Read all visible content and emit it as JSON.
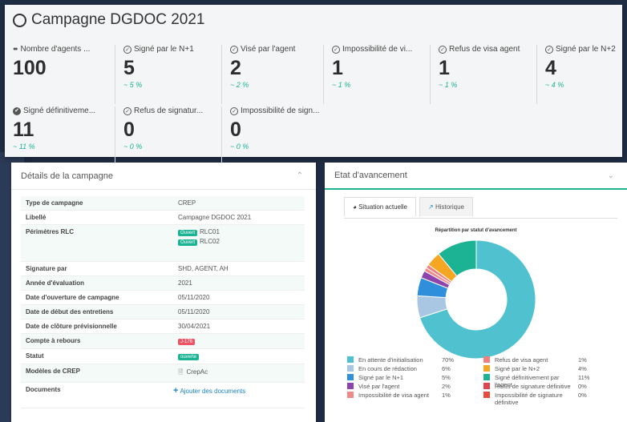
{
  "header": {
    "title": "Campagne DGDOC 2021"
  },
  "stats": [
    {
      "icon": "users-icon",
      "label": "Nombre d'agents ...",
      "value": "100",
      "pct": ""
    },
    {
      "icon": "check-circle-icon",
      "label": "Signé par le N+1",
      "value": "5",
      "pct": "~ 5 %"
    },
    {
      "icon": "check-circle-icon",
      "label": "Visé par l'agent",
      "value": "2",
      "pct": "~ 2 %"
    },
    {
      "icon": "check-circle-icon",
      "label": "Impossibilité de vi...",
      "value": "1",
      "pct": "~ 1 %"
    },
    {
      "icon": "check-circle-icon",
      "label": "Refus de visa agent",
      "value": "1",
      "pct": "~ 1 %"
    },
    {
      "icon": "check-circle-icon",
      "label": "Signé par le N+2",
      "value": "4",
      "pct": "~ 4 %"
    },
    {
      "icon": "check-circle-filled-icon",
      "label": "Signé définitiveme...",
      "value": "11",
      "pct": "~ 11 %"
    },
    {
      "icon": "check-circle-icon",
      "label": "Refus de signatur...",
      "value": "0",
      "pct": "~ 0 %"
    },
    {
      "icon": "check-circle-icon",
      "label": "Impossibilité de sign...",
      "value": "0",
      "pct": "~ 0 %"
    }
  ],
  "details": {
    "title": "Détails de la campagne",
    "rows": [
      {
        "key": "Type de campagne",
        "value": "CREP"
      },
      {
        "key": "Libellé",
        "value": "Campagne DGDOC 2021"
      },
      {
        "key": "Périmètres RLC",
        "tag": "Ouvert",
        "value": "RLC01",
        "tag2": "Ouvert",
        "value2": "RLC02"
      },
      {
        "key": "Signature par",
        "value": "SHD, AGENT, AH"
      },
      {
        "key": "Année d'évaluation",
        "value": "2021"
      },
      {
        "key": "Date d'ouverture de campagne",
        "value": "05/11/2020"
      },
      {
        "key": "Date de début des entretiens",
        "value": "05/11/2020"
      },
      {
        "key": "Date de clôture prévisionnelle",
        "value": "30/04/2021"
      },
      {
        "key": "Compte à rebours",
        "tag": "J-176"
      },
      {
        "key": "Statut",
        "tag": "ouverte"
      },
      {
        "key": "Modèles de CREP",
        "value": "CrepAc"
      },
      {
        "key": "Documents",
        "link": "Ajouter des documents"
      }
    ]
  },
  "progress": {
    "title": "Etat d'avancement",
    "tabs": [
      "Situation actuelle",
      "Historique"
    ]
  },
  "chart_data": {
    "type": "pie",
    "title": "Répartition par statut d'avancement",
    "slices": [
      {
        "name": "En attente d'initialisation",
        "value": 70,
        "label": "70%",
        "color": "#4fc1cf"
      },
      {
        "name": "En cours de rédaction",
        "value": 6,
        "label": "6%",
        "color": "#a9c6e2"
      },
      {
        "name": "Signé par le N+1",
        "value": 5,
        "label": "5%",
        "color": "#2f8fdb"
      },
      {
        "name": "Visé par l'agent",
        "value": 2,
        "label": "2%",
        "color": "#8e44ad"
      },
      {
        "name": "Impossibilité de visa agent",
        "value": 1,
        "label": "1%",
        "color": "#f08a8a"
      },
      {
        "name": "Refus de visa agent",
        "value": 1,
        "label": "1%",
        "color": "#f08080"
      },
      {
        "name": "Signé par le N+2",
        "value": 4,
        "label": "4%",
        "color": "#f5a623"
      },
      {
        "name": "Signé définitivement par l'agent",
        "value": 11,
        "label": "11%",
        "color": "#1bb394"
      },
      {
        "name": "Refus de signature définitive",
        "value": 0,
        "label": "0%",
        "color": "#e0474c"
      },
      {
        "name": "Impossibilité de signature définitive",
        "value": 0,
        "label": "0%",
        "color": "#e74c3c"
      }
    ],
    "legend_order": [
      [
        "En attente d'initialisation",
        "Refus de visa agent"
      ],
      [
        "En cours de rédaction",
        "Signé par le N+2"
      ],
      [
        "Signé par le N+1",
        "Signé définitivement par l'agent"
      ],
      [
        "Visé par l'agent",
        "Refus de signature définitive"
      ],
      [
        "Impossibilité de visa agent",
        "Impossibilité de signature définitive"
      ]
    ]
  }
}
